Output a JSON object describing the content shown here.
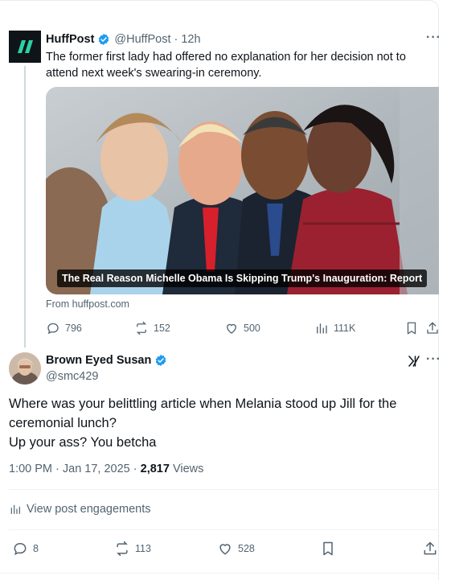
{
  "parent": {
    "author_name": "HuffPost",
    "handle": "@HuffPost",
    "time": "12h",
    "separator": "·",
    "text": "The former first lady had offered no explanation for her decision not to attend next week's swearing-in ceremony.",
    "card_title": "The Real Reason Michelle Obama Is Skipping Trump's Inauguration: Report",
    "source": "From huffpost.com",
    "replies": "796",
    "reposts": "152",
    "likes": "500",
    "views": "111K",
    "more": "···"
  },
  "main": {
    "author_name": "Brown Eyed Susan",
    "handle": "@smc429",
    "more": "···",
    "grok_icon": "x̸l",
    "text_lines": [
      "Where was your belittling article when Melania stood up Jill for the",
      "ceremonial lunch?",
      "Up your ass? You betcha"
    ],
    "timestamp": "1:00 PM · Jan 17, 2025 · ",
    "views_count": "2,817",
    "views_label": " Views",
    "engagements_label": "View post engagements",
    "replies": "8",
    "reposts": "113",
    "likes": "528"
  },
  "colors": {
    "verified": "#1d9bf0",
    "muted": "#536471",
    "text": "#0f1419",
    "huffpost_green": "#2bd2a4"
  }
}
